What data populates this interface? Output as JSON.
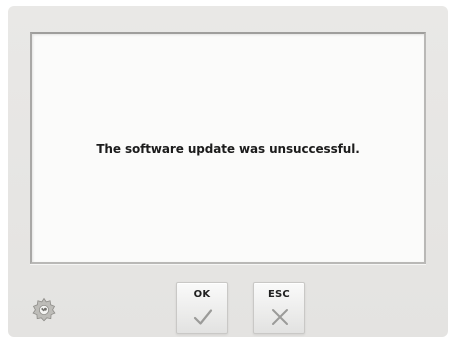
{
  "dialog": {
    "message": "The software update was unsuccessful."
  },
  "buttons": {
    "ok_label": "OK",
    "esc_label": "ESC"
  },
  "icons": {
    "settings": "gear-icon",
    "ok": "checkmark-icon",
    "esc": "cross-icon"
  }
}
